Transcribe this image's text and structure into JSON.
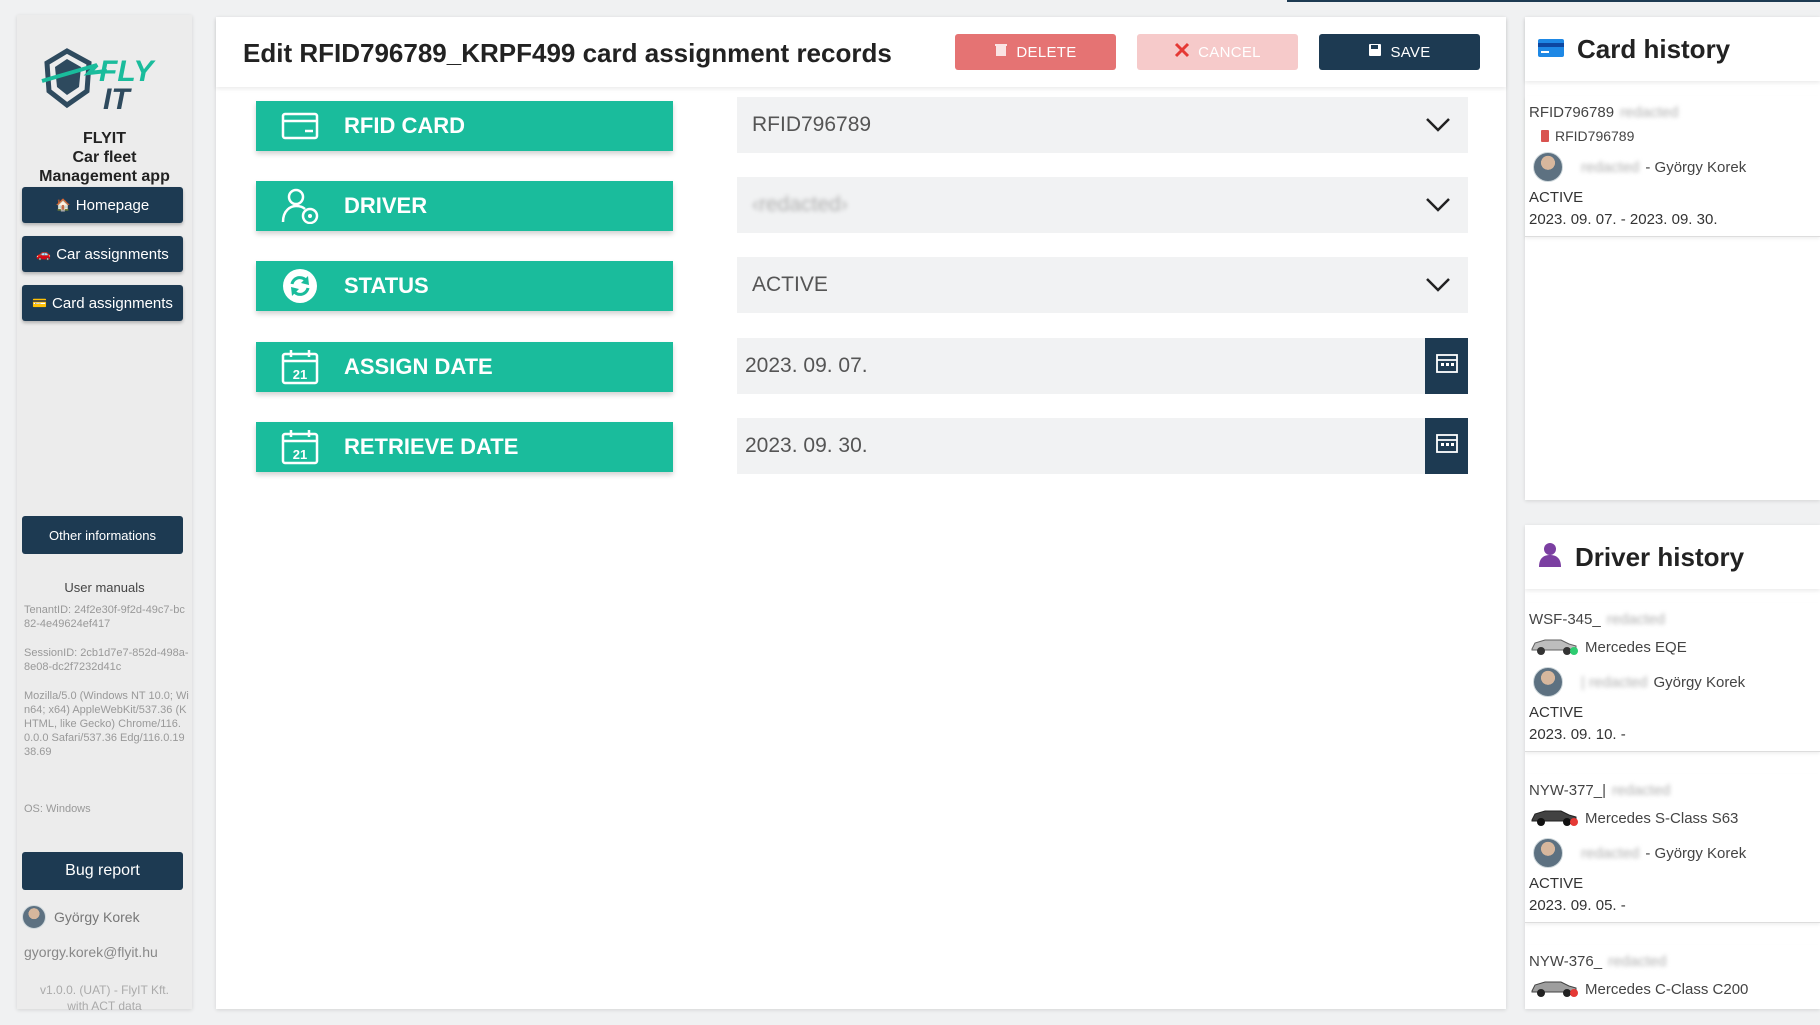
{
  "app": {
    "logo_text": "FLY IT",
    "name_line1": "FLYIT",
    "name_line2": "Car fleet",
    "name_line3": "Management app"
  },
  "sidebar": {
    "nav": [
      {
        "label": "Homepage",
        "icon": "home-icon"
      },
      {
        "label": "Car assignments",
        "icon": "car-icon"
      },
      {
        "label": "Card assignments",
        "icon": "card-icon"
      }
    ],
    "other_label": "Other informations",
    "manuals_label": "User manuals",
    "tenant": "TenantID: 24f2e30f-9f2d-49c7-bc82-4e49624ef417",
    "session": "SessionID: 2cb1d7e7-852d-498a-8e08-dc2f7232d41c",
    "useragent": "Mozilla/5.0 (Windows NT 10.0; Win64; x64) AppleWebKit/537.36 (KHTML, like Gecko) Chrome/116.0.0.0 Safari/537.36 Edg/116.0.1938.69",
    "os": "OS: Windows",
    "bug_label": "Bug report",
    "user_name": "György Korek",
    "user_email": "gyorgy.korek@flyit.hu",
    "version_line1": "v1.0.0. (UAT) - FlyIT Kft.",
    "version_line2": "with ACT data"
  },
  "main": {
    "title": "Edit RFID796789_KRPF499 card assignment records",
    "delete_label": "DELETE",
    "cancel_label": "CANCEL",
    "save_label": "SAVE",
    "fields": {
      "rfid_label": "RFID CARD",
      "rfid_value": "RFID796789",
      "driver_label": "DRIVER",
      "driver_value": "‹redacted›",
      "status_label": "STATUS",
      "status_value": "ACTIVE",
      "assign_label": "ASSIGN DATE",
      "assign_value": "2023. 09. 07.",
      "retrieve_label": "RETRIEVE DATE",
      "retrieve_value": "2023. 09. 30.",
      "calendar_day": "21"
    }
  },
  "card_history": {
    "title": "Card history",
    "entries": [
      {
        "card": "RFID796789",
        "card_suffix": "redacted",
        "card_tag": "RFID796789",
        "driver_prefix": "redacted",
        "driver": "- György Korek",
        "status": "ACTIVE",
        "dates": "2023. 09. 07. - 2023. 09. 30."
      }
    ]
  },
  "driver_history": {
    "title": "Driver history",
    "entries": [
      {
        "plate": "WSF-345_",
        "plate_suffix": "redacted",
        "car": "Mercedes EQE",
        "driver_prefix": "| redacted",
        "driver": "György Korek",
        "status": "ACTIVE",
        "dates": "2023. 09. 10. -",
        "dot": "#2ecc71"
      },
      {
        "plate": "NYW-377_|",
        "plate_suffix": "redacted",
        "car": "Mercedes S-Class S63",
        "driver_prefix": "redacted",
        "driver": "- György Korek",
        "status": "ACTIVE",
        "dates": "2023. 09. 05. -",
        "dot": "#e53935"
      },
      {
        "plate": "NYW-376_",
        "plate_suffix": "redacted",
        "car": "Mercedes C-Class C200",
        "dot": "#e53935"
      }
    ]
  },
  "colors": {
    "primary": "#1d3a52",
    "accent": "#1abc9c",
    "delete": "#e57373",
    "cancel": "#f6caca"
  }
}
